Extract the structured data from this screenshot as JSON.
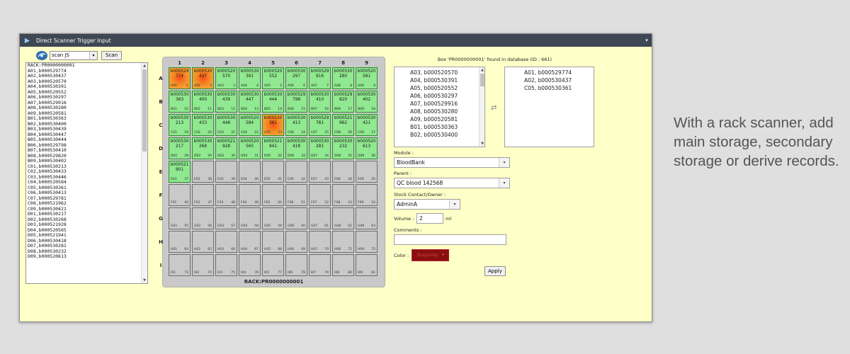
{
  "window": {
    "title": "Direct Scanner Trigger Input",
    "dropdown_glyph": "▾"
  },
  "toolbar": {
    "scanner_value": "scan JS",
    "scan_label": "Scan"
  },
  "raw_lines": [
    "RACK:PR0000000001",
    "A01,b000529774",
    "A02,b000530437",
    "A03,b000520570",
    "A04,b000530391",
    "A05,b000520552",
    "A06,b000530297",
    "A07,b000529916",
    "A08,b000530280",
    "A09,b000520581",
    "B01,b000530363",
    "B02,b000530400",
    "B03,b000530439",
    "B04,b000530447",
    "B05,b000530444",
    "B06,b000529798",
    "B07,b000530410",
    "B08,b000529820",
    "B09,b000530402",
    "C01,b000530213",
    "C02,b000530433",
    "C03,b000530446",
    "C04,b000520584",
    "C05,b000530361",
    "C06,b000530413",
    "C07,b000529781",
    "C08,b000521962",
    "C09,b000530421",
    "D01,b000530217",
    "D02,b000530268",
    "D03,b000521928",
    "D04,b000520565",
    "D05,b000521941",
    "D06,b000530418",
    "D07,b000530281",
    "D08,b000530232",
    "D09,b000520613"
  ],
  "rack": {
    "label": "RACK:PR0000000001",
    "columns": [
      "1",
      "2",
      "3",
      "4",
      "5",
      "6",
      "7",
      "8",
      "9"
    ],
    "rows": [
      "A",
      "B",
      "C",
      "D",
      "E",
      "F",
      "G",
      "H",
      "I"
    ],
    "wells": [
      {
        "pos": "A01",
        "num": "1",
        "code": [
          "b000529",
          "774"
        ],
        "filled": true,
        "highlight": true
      },
      {
        "pos": "A02",
        "num": "2",
        "code": [
          "b000530",
          "437"
        ],
        "filled": true,
        "highlight": true
      },
      {
        "pos": "A03",
        "num": "3",
        "code": [
          "b000520",
          "570"
        ],
        "filled": true
      },
      {
        "pos": "A04",
        "num": "4",
        "code": [
          "b000530",
          "391"
        ],
        "filled": true
      },
      {
        "pos": "A05",
        "num": "5",
        "code": [
          "b000520",
          "552"
        ],
        "filled": true
      },
      {
        "pos": "A06",
        "num": "6",
        "code": [
          "b000530",
          "297"
        ],
        "filled": true
      },
      {
        "pos": "A07",
        "num": "7",
        "code": [
          "b000529",
          "916"
        ],
        "filled": true
      },
      {
        "pos": "A08",
        "num": "8",
        "code": [
          "b000530",
          "280"
        ],
        "filled": true
      },
      {
        "pos": "A09",
        "num": "9",
        "code": [
          "b000520",
          "581"
        ],
        "filled": true
      },
      {
        "pos": "B01",
        "num": "10",
        "code": [
          "b000530",
          "363"
        ],
        "filled": true
      },
      {
        "pos": "B02",
        "num": "11",
        "code": [
          "b000530",
          "400"
        ],
        "filled": true
      },
      {
        "pos": "B03",
        "num": "12",
        "code": [
          "b000530",
          "439"
        ],
        "filled": true
      },
      {
        "pos": "B04",
        "num": "13",
        "code": [
          "b000530",
          "447"
        ],
        "filled": true
      },
      {
        "pos": "B05",
        "num": "14",
        "code": [
          "b000530",
          "444"
        ],
        "filled": true
      },
      {
        "pos": "B06",
        "num": "15",
        "code": [
          "b000529",
          "798"
        ],
        "filled": true
      },
      {
        "pos": "B07",
        "num": "16",
        "code": [
          "b000530",
          "410"
        ],
        "filled": true
      },
      {
        "pos": "B08",
        "num": "17",
        "code": [
          "b000529",
          "820"
        ],
        "filled": true
      },
      {
        "pos": "B09",
        "num": "18",
        "code": [
          "b000530",
          "402"
        ],
        "filled": true
      },
      {
        "pos": "C01",
        "num": "19",
        "code": [
          "b000530",
          "213"
        ],
        "filled": true
      },
      {
        "pos": "C02",
        "num": "20",
        "code": [
          "b000530",
          "433"
        ],
        "filled": true
      },
      {
        "pos": "C03",
        "num": "21",
        "code": [
          "b000530",
          "446"
        ],
        "filled": true
      },
      {
        "pos": "C04",
        "num": "22",
        "code": [
          "b000520",
          "584"
        ],
        "filled": true
      },
      {
        "pos": "C05",
        "num": "23",
        "code": [
          "b000530",
          "361"
        ],
        "filled": true,
        "highlight": true
      },
      {
        "pos": "C06",
        "num": "24",
        "code": [
          "b000530",
          "413"
        ],
        "filled": true
      },
      {
        "pos": "C07",
        "num": "25",
        "code": [
          "b000529",
          "781"
        ],
        "filled": true
      },
      {
        "pos": "C08",
        "num": "26",
        "code": [
          "b000521",
          "962"
        ],
        "filled": true
      },
      {
        "pos": "C09",
        "num": "27",
        "code": [
          "b000530",
          "421"
        ],
        "filled": true
      },
      {
        "pos": "D01",
        "num": "28",
        "code": [
          "b000530",
          "217"
        ],
        "filled": true
      },
      {
        "pos": "D02",
        "num": "29",
        "code": [
          "b000530",
          "268"
        ],
        "filled": true
      },
      {
        "pos": "D03",
        "num": "30",
        "code": [
          "b000521",
          "928"
        ],
        "filled": true
      },
      {
        "pos": "D04",
        "num": "31",
        "code": [
          "b000520",
          "565"
        ],
        "filled": true
      },
      {
        "pos": "D05",
        "num": "32",
        "code": [
          "b000521",
          "941"
        ],
        "filled": true
      },
      {
        "pos": "D06",
        "num": "33",
        "code": [
          "b000530",
          "418"
        ],
        "filled": true
      },
      {
        "pos": "D07",
        "num": "34",
        "code": [
          "b000530",
          "281"
        ],
        "filled": true
      },
      {
        "pos": "D08",
        "num": "35",
        "code": [
          "b000530",
          "232"
        ],
        "filled": true
      },
      {
        "pos": "D09",
        "num": "36",
        "code": [
          "b000520",
          "613"
        ],
        "filled": true
      },
      {
        "pos": "E01",
        "num": "37",
        "code": [
          "b000521",
          "901"
        ],
        "filled": true
      },
      {
        "pos": "E02",
        "num": "38"
      },
      {
        "pos": "E03",
        "num": "39"
      },
      {
        "pos": "E04",
        "num": "40"
      },
      {
        "pos": "E05",
        "num": "41"
      },
      {
        "pos": "E06",
        "num": "42"
      },
      {
        "pos": "E07",
        "num": "43"
      },
      {
        "pos": "E08",
        "num": "44"
      },
      {
        "pos": "E09",
        "num": "45"
      },
      {
        "pos": "F01",
        "num": "46"
      },
      {
        "pos": "F02",
        "num": "47"
      },
      {
        "pos": "F03",
        "num": "48"
      },
      {
        "pos": "F04",
        "num": "49"
      },
      {
        "pos": "F05",
        "num": "50"
      },
      {
        "pos": "F06",
        "num": "51"
      },
      {
        "pos": "F07",
        "num": "52"
      },
      {
        "pos": "F08",
        "num": "53"
      },
      {
        "pos": "F09",
        "num": "54"
      },
      {
        "pos": "G01",
        "num": "55"
      },
      {
        "pos": "G02",
        "num": "56"
      },
      {
        "pos": "G03",
        "num": "57"
      },
      {
        "pos": "G04",
        "num": "58"
      },
      {
        "pos": "G05",
        "num": "59"
      },
      {
        "pos": "G06",
        "num": "60"
      },
      {
        "pos": "G07",
        "num": "61"
      },
      {
        "pos": "G08",
        "num": "62"
      },
      {
        "pos": "G09",
        "num": "63"
      },
      {
        "pos": "H01",
        "num": "64"
      },
      {
        "pos": "H02",
        "num": "65"
      },
      {
        "pos": "H03",
        "num": "66"
      },
      {
        "pos": "H04",
        "num": "67"
      },
      {
        "pos": "H05",
        "num": "68"
      },
      {
        "pos": "H06",
        "num": "69"
      },
      {
        "pos": "H07",
        "num": "70"
      },
      {
        "pos": "H08",
        "num": "71"
      },
      {
        "pos": "H09",
        "num": "72"
      },
      {
        "pos": "I01",
        "num": "73"
      },
      {
        "pos": "I02",
        "num": "74"
      },
      {
        "pos": "I03",
        "num": "75"
      },
      {
        "pos": "I04",
        "num": "76"
      },
      {
        "pos": "I05",
        "num": "77"
      },
      {
        "pos": "I06",
        "num": "78"
      },
      {
        "pos": "I07",
        "num": "79"
      },
      {
        "pos": "I08",
        "num": "80"
      },
      {
        "pos": "I09",
        "num": "81"
      }
    ]
  },
  "found_text": "Box 'PR0000000001' found in database (ID : 661)",
  "available_list": [
    "A03, b000520570",
    "A04, b000530391",
    "A05, b000520552",
    "A06, b000530297",
    "A07, b000529916",
    "A08, b000530280",
    "A09, b000520581",
    "B01, b000530363",
    "B02, b000530400"
  ],
  "selected_list": [
    "A01, b000529774",
    "A02, b000530437",
    "C05, b000530361"
  ],
  "swap_glyph": "⇄",
  "form": {
    "module_label": "Module :",
    "module_value": "BloodBank",
    "parent_label": "Parent :",
    "parent_value": "QC blood 142568",
    "owner_label": "Stock Contact/Owner :",
    "owner_value": "AdminA",
    "volume_label": "Volume :",
    "volume_value": "2",
    "volume_unit": "ml",
    "comments_label": "Comments :",
    "comments_value": "",
    "color_label": "Color :",
    "color_value": "Burgundy",
    "apply_label": "Apply"
  },
  "colors": {
    "filled_well": "#90e890",
    "highlight_well": "#f5a032",
    "window_bg": "#ffffc8",
    "color_swatch": "#8b0f0f"
  },
  "caption": "With a rack scanner, add main storage, secondary storage or derive records."
}
